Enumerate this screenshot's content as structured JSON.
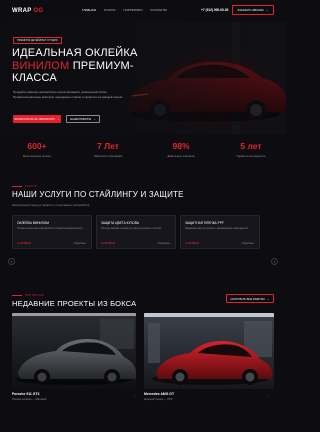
{
  "header": {
    "logo_main": "WRAP",
    "logo_accent": "OG",
    "nav": [
      "ГЛАВНАЯ",
      "УСЛУГИ",
      "ПОРТФОЛИО",
      "КОНТАКТЫ"
    ],
    "phone": "+7 (912) 000-00-00",
    "cta_label": "ЗАКАЗАТЬ ЗВОНОК"
  },
  "hero": {
    "badge": "ПРЕМИУМ ДЕТЕЙЛИНГ СТУДИЯ",
    "title_line1": "ИДЕАЛЬНАЯ ОКЛЕЙКА",
    "title_accent": "ВИНИЛОМ",
    "title_line2_rest": "ПРЕМИУМ-",
    "title_line3": "КЛАССА",
    "description": "Придайте вашему автомобилю неповторимый и уникальный облик. Профессиональные мастера, передовые плёнки и гарантия на каждый проект.",
    "primary_button": "ЗАПИСАТЬСЯ НА ОБРАБОТКУ",
    "secondary_button": "НАШИ РАБОТЫ"
  },
  "stats": [
    {
      "value": "600+",
      "label": "Выполненных оклеек"
    },
    {
      "value": "7 Лет",
      "label": "Работаем с брендами"
    },
    {
      "value": "98%",
      "label": "Довольных клиентов"
    },
    {
      "value": "5 лет",
      "label": "Гарантия на покрытие"
    }
  ],
  "services": {
    "kicker": "УСЛУГИ",
    "title": "НАШИ УСЛУГИ ПО СТАЙЛИНГУ И ЗАЩИТЕ",
    "subtitle": "Комплексный подход к защите и стилю вашего автомобиля.",
    "cards": [
      {
        "title": "ОКЛЕЙКА ВИНИЛОМ",
        "desc": "Полная смена цвета автомобиля плёнкой премиум-класса.",
        "price": "от 90 000 ₽",
        "more": "Подробнее"
      },
      {
        "title": "ЗАЩИТА ЦВЕТА КУЗОВА",
        "desc": "Полиуретановая плёнка для защиты кузова от сколов.",
        "price": "от 80 000 ₽",
        "more": "Подробнее"
      },
      {
        "title": "ЗАЩИТНАЯ ПЛЁНКА PPF",
        "desc": "Надёжная защита кузова от механических повреждений.",
        "price": "от 60 000 ₽",
        "more": "Подробнее"
      }
    ]
  },
  "projects": {
    "kicker": "ПОРТФОЛИО",
    "title": "НЕДАВНИЕ ПРОЕКТЫ ИЗ БОКСА",
    "button": "СМОТРЕТЬ ВСЕ РАБОТЫ",
    "items": [
      {
        "name": "Porsche 911 GT3",
        "subtitle": "Полная оклейка — Матовый"
      },
      {
        "name": "Mercedes AMG GT",
        "subtitle": "Красный глянец — PPF"
      }
    ]
  },
  "colors": {
    "accent": "#e5222c",
    "background": "#0d0d11",
    "card": "#16161c"
  }
}
